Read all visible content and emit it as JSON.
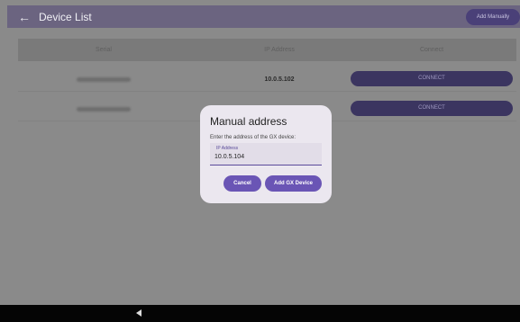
{
  "appbar": {
    "back_icon": "arrow-left-icon",
    "title": "Device List",
    "add_manual_label": "Add Manually"
  },
  "table": {
    "headers": [
      "Serial",
      "IP Address",
      "Connect"
    ],
    "rows": [
      {
        "serial": "",
        "ip": "10.0.5.102",
        "connect_label": "CONNECT"
      },
      {
        "serial": "",
        "ip": "",
        "connect_label": "CONNECT"
      }
    ]
  },
  "dialog": {
    "title": "Manual address",
    "prompt": "Enter the address of the GX device:",
    "field_label": "IP Address",
    "field_value": "10.0.5.104",
    "cancel_label": "Cancel",
    "add_label": "Add GX Device"
  },
  "navbar": {
    "back_icon": "nav-back-triangle-icon"
  }
}
